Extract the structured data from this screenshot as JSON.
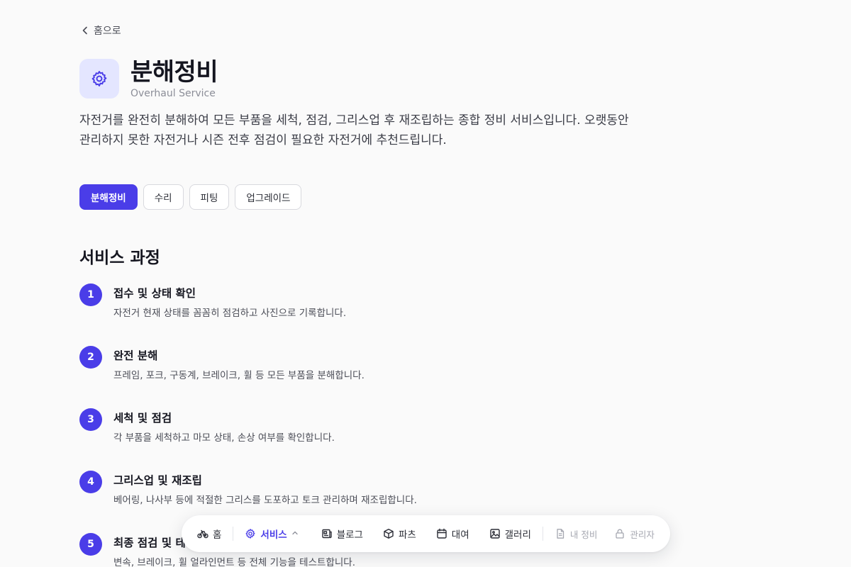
{
  "back": {
    "label": "홈으로"
  },
  "hero": {
    "title": "분해정비",
    "subtitle": "Overhaul Service",
    "icon": "gear-icon"
  },
  "description": "자전거를 완전히 분해하여 모든 부품을 세척, 점검, 그리스업 후 재조립하는 종합 정비 서비스입니다. 오랫동안 관리하지 못한 자전거나 시즌 전후 점검이 필요한 자전거에 추천드립니다.",
  "tabs": [
    {
      "label": "분해정비",
      "active": true
    },
    {
      "label": "수리",
      "active": false
    },
    {
      "label": "피팅",
      "active": false
    },
    {
      "label": "업그레이드",
      "active": false
    }
  ],
  "section_title": "서비스 과정",
  "steps": [
    {
      "num": "1",
      "title": "접수 및 상태 확인",
      "desc": "자전거 현재 상태를 꼼꼼히 점검하고 사진으로 기록합니다."
    },
    {
      "num": "2",
      "title": "완전 분해",
      "desc": "프레임, 포크, 구동계, 브레이크, 휠 등 모든 부품을 분해합니다."
    },
    {
      "num": "3",
      "title": "세척 및 점검",
      "desc": "각 부품을 세척하고 마모 상태, 손상 여부를 확인합니다."
    },
    {
      "num": "4",
      "title": "그리스업 및 재조립",
      "desc": "베어링, 나사부 등에 적절한 그리스를 도포하고 토크 관리하며 재조립합니다."
    },
    {
      "num": "5",
      "title": "최종 점검 및 테",
      "desc": "변속, 브레이크, 휠 얼라인먼트 등 전체 기능을 테스트합니다."
    }
  ],
  "nav": {
    "home": "홈",
    "services": "서비스",
    "blog": "블로그",
    "parts": "파츠",
    "rental": "대여",
    "gallery": "갤러리",
    "my_service": "내 정비",
    "admin": "관리자"
  },
  "colors": {
    "accent": "#4a3de8",
    "accent_light": "#e4e6ff",
    "background": "#fafafa"
  }
}
